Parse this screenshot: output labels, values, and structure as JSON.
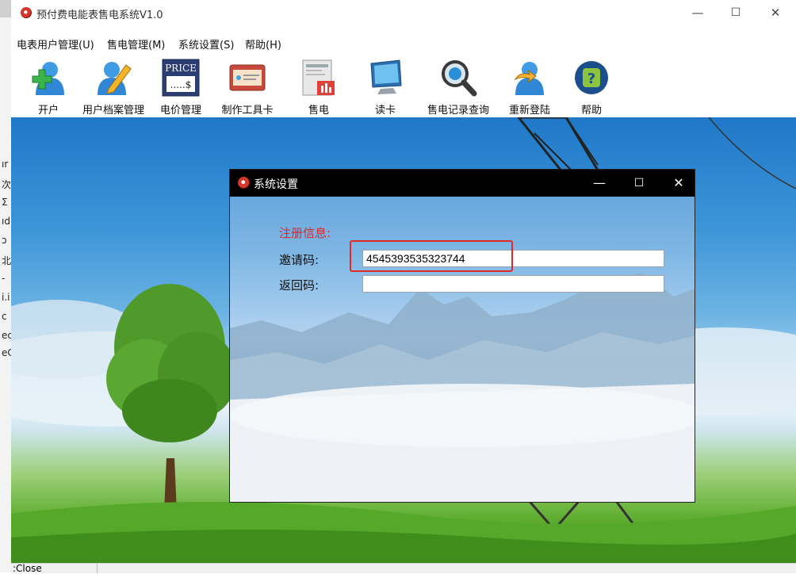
{
  "window": {
    "title": "预付费电能表售电系统V1.0",
    "controls": {
      "minimize": "—",
      "maximize": "☐",
      "close": "✕"
    }
  },
  "menu": [
    "电表用户管理(U)",
    "售电管理(M)",
    "系统设置(S)",
    "帮助(H)"
  ],
  "toolbar": [
    {
      "label": "开户",
      "icon": "add-user-icon"
    },
    {
      "label": "用户档案管理",
      "icon": "edit-user-icon"
    },
    {
      "label": "电价管理",
      "icon": "price-icon",
      "icon_text_top": "PRICE",
      "icon_text_bottom": ".....$"
    },
    {
      "label": "制作工具卡",
      "icon": "card-icon"
    },
    {
      "label": "售电",
      "icon": "sell-icon"
    },
    {
      "label": "读卡",
      "icon": "monitor-icon"
    },
    {
      "label": "售电记录查询",
      "icon": "magnifier-icon"
    },
    {
      "label": "重新登陆",
      "icon": "relogin-icon"
    },
    {
      "label": "帮助",
      "icon": "help-icon"
    }
  ],
  "dialog": {
    "title": "系统设置",
    "controls": {
      "minimize": "—",
      "maximize": "☐",
      "close": "✕"
    },
    "section_label": "注册信息:",
    "invite_label": "邀请码:",
    "invite_value": "4545393535323744",
    "return_label": "返回码:",
    "return_value": ""
  },
  "status": {
    "text": ":Close"
  },
  "left_strip_fragments": [
    "ır",
    "次",
    "Σ",
    "ıd",
    "ɔ",
    "北",
    "-",
    "i.i",
    "c",
    "ec",
    "eC"
  ]
}
